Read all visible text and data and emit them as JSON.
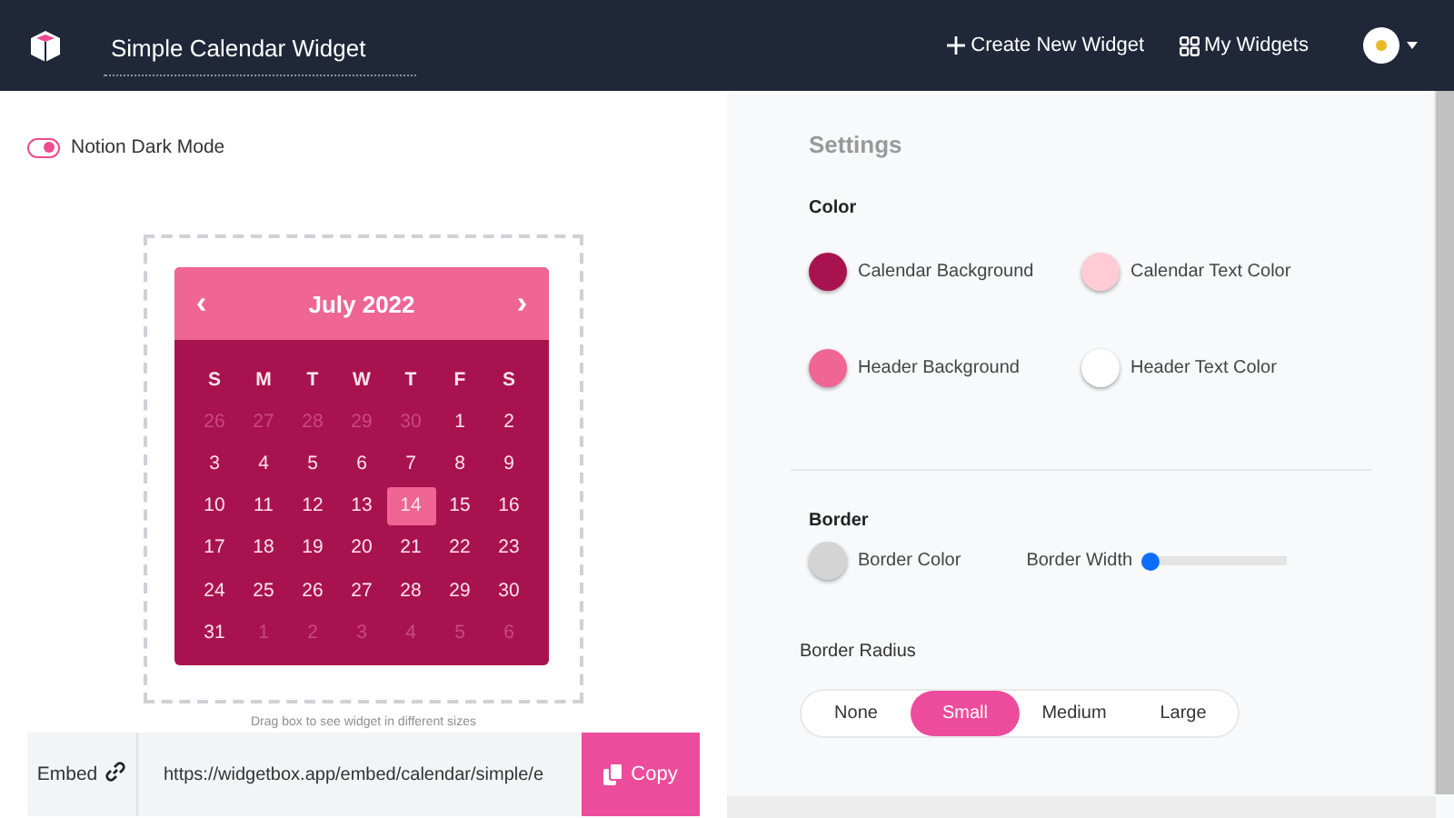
{
  "header": {
    "title": "Simple Calendar Widget",
    "nav": [
      {
        "kind": "create",
        "label": "Create New Widget"
      },
      {
        "kind": "widgets",
        "label": "My Widgets"
      }
    ]
  },
  "dark_mode": {
    "label": "Notion Dark Mode",
    "on": true
  },
  "calendar": {
    "month": "July 2022",
    "prev": "‹",
    "next": "›",
    "weekdays": [
      "S",
      "M",
      "T",
      "W",
      "T",
      "F",
      "S"
    ],
    "days": [
      {
        "text": "26",
        "muted": true,
        "selected": false
      },
      {
        "text": "27",
        "muted": true,
        "selected": false
      },
      {
        "text": "28",
        "muted": true,
        "selected": false
      },
      {
        "text": "29",
        "muted": true,
        "selected": false
      },
      {
        "text": "30",
        "muted": true,
        "selected": false
      },
      {
        "text": "1",
        "muted": false,
        "selected": false
      },
      {
        "text": "2",
        "muted": false,
        "selected": false
      },
      {
        "text": "3",
        "muted": false,
        "selected": false
      },
      {
        "text": "4",
        "muted": false,
        "selected": false
      },
      {
        "text": "5",
        "muted": false,
        "selected": false
      },
      {
        "text": "6",
        "muted": false,
        "selected": false
      },
      {
        "text": "7",
        "muted": false,
        "selected": false
      },
      {
        "text": "8",
        "muted": false,
        "selected": false
      },
      {
        "text": "9",
        "muted": false,
        "selected": false
      },
      {
        "text": "10",
        "muted": false,
        "selected": false
      },
      {
        "text": "11",
        "muted": false,
        "selected": false
      },
      {
        "text": "12",
        "muted": false,
        "selected": false
      },
      {
        "text": "13",
        "muted": false,
        "selected": false
      },
      {
        "text": "14",
        "muted": false,
        "selected": true
      },
      {
        "text": "15",
        "muted": false,
        "selected": false
      },
      {
        "text": "16",
        "muted": false,
        "selected": false
      },
      {
        "text": "17",
        "muted": false,
        "selected": false
      },
      {
        "text": "18",
        "muted": false,
        "selected": false
      },
      {
        "text": "19",
        "muted": false,
        "selected": false
      },
      {
        "text": "20",
        "muted": false,
        "selected": false
      },
      {
        "text": "21",
        "muted": false,
        "selected": false
      },
      {
        "text": "22",
        "muted": false,
        "selected": false
      },
      {
        "text": "23",
        "muted": false,
        "selected": false
      },
      {
        "text": "24",
        "muted": false,
        "selected": false
      },
      {
        "text": "25",
        "muted": false,
        "selected": false
      },
      {
        "text": "26",
        "muted": false,
        "selected": false
      },
      {
        "text": "27",
        "muted": false,
        "selected": false
      },
      {
        "text": "28",
        "muted": false,
        "selected": false
      },
      {
        "text": "29",
        "muted": false,
        "selected": false
      },
      {
        "text": "30",
        "muted": false,
        "selected": false
      },
      {
        "text": "31",
        "muted": false,
        "selected": false
      },
      {
        "text": "1",
        "muted": true,
        "selected": false
      },
      {
        "text": "2",
        "muted": true,
        "selected": false
      },
      {
        "text": "3",
        "muted": true,
        "selected": false
      },
      {
        "text": "4",
        "muted": true,
        "selected": false
      },
      {
        "text": "5",
        "muted": true,
        "selected": false
      },
      {
        "text": "6",
        "muted": true,
        "selected": false
      }
    ]
  },
  "resize_hint": "Drag box to see widget in different sizes",
  "embed": {
    "label": "Embed",
    "url": "https://widgetbox.app/embed/calendar/simple/e",
    "button": "Copy"
  },
  "settings": {
    "title": "Settings",
    "color_heading": "Color",
    "colors": [
      {
        "label": "Calendar Background",
        "color": "#a8134f"
      },
      {
        "label": "Calendar Text Color",
        "color": "#ffccd5"
      },
      {
        "label": "Header Background",
        "color": "#ef6593"
      },
      {
        "label": "Header Text Color",
        "color": "#ffffff"
      }
    ],
    "border_heading": "Border",
    "border_color": {
      "label": "Border Color",
      "color": "#d4d4d4"
    },
    "border_width": {
      "label": "Border Width",
      "level": 0.0
    },
    "radius_heading": "Border Radius",
    "radius_options": [
      {
        "label": "None",
        "selected": false
      },
      {
        "label": "Small",
        "selected": true
      },
      {
        "label": "Medium",
        "selected": false
      },
      {
        "label": "Large",
        "selected": false
      }
    ]
  }
}
